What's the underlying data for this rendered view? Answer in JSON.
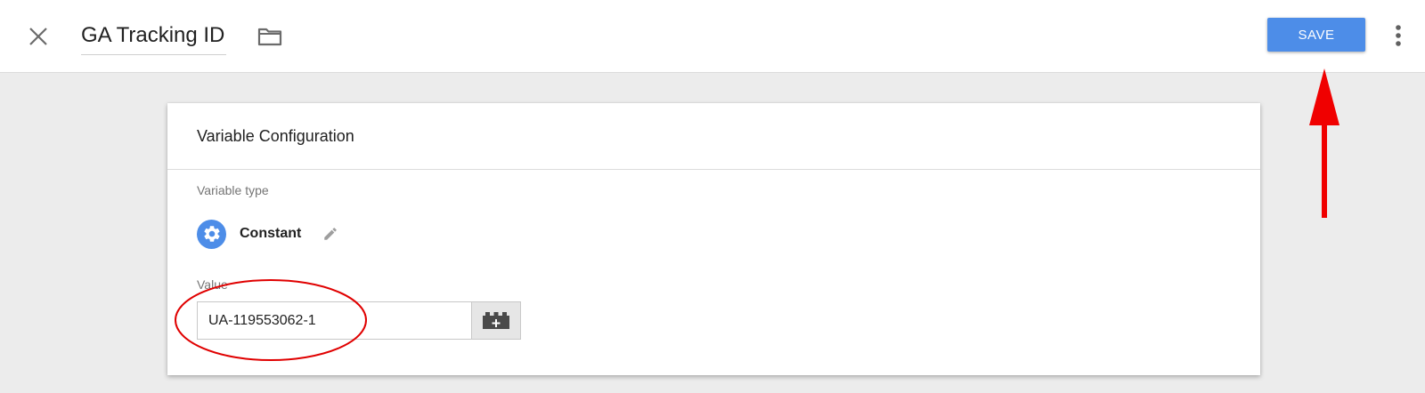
{
  "header": {
    "title": "GA Tracking ID",
    "save_label": "SAVE",
    "close_icon": "close-icon",
    "folder_icon": "folder-icon",
    "more_icon": "more-vert-icon"
  },
  "card": {
    "title": "Variable Configuration",
    "variable_type_label": "Variable type",
    "variable_type_name": "Constant",
    "variable_type_icon": "gear-icon",
    "edit_icon": "pencil-icon",
    "value_label": "Value",
    "value": "UA-119553062-1",
    "variable_picker_icon": "add-variable-icon"
  },
  "colors": {
    "accent": "#4d8de8",
    "annotation": "#e00000"
  }
}
